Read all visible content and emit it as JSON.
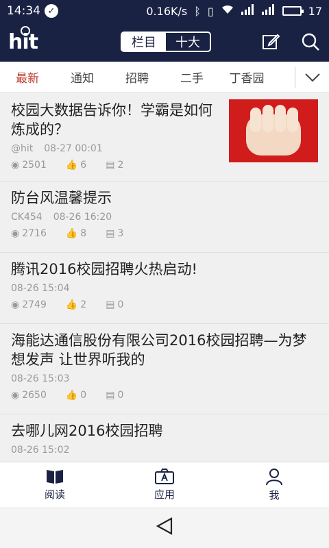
{
  "status": {
    "time": "14:34",
    "speed": "0.16K/s",
    "battery": "17"
  },
  "appbar": {
    "logo": "hit",
    "seg_left": "栏目",
    "seg_right": "十大"
  },
  "tabs": [
    "最新",
    "通知",
    "招聘",
    "二手",
    "丁香园"
  ],
  "articles": [
    {
      "title": "校园大数据告诉你！学霸是如何炼成的？",
      "author": "@hit",
      "time": "08-27 00:01",
      "views": "2501",
      "likes": "6",
      "comments": "2",
      "has_thumb": true
    },
    {
      "title": "防台风温馨提示",
      "author": "CK454",
      "time": "08-26 16:20",
      "views": "2716",
      "likes": "8",
      "comments": "3"
    },
    {
      "title": "腾讯2016校园招聘火热启动!",
      "author": "",
      "time": "08-26 15:04",
      "views": "2749",
      "likes": "2",
      "comments": "0"
    },
    {
      "title": "海能达通信股份有限公司2016校园招聘—为梦想发声 让世界听我的",
      "author": "",
      "time": "08-26 15:03",
      "views": "2650",
      "likes": "0",
      "comments": "0"
    },
    {
      "title": "去哪儿网2016校园招聘",
      "author": "",
      "time": "08-26 15:02",
      "views": "",
      "likes": "",
      "comments": ""
    }
  ],
  "nav": {
    "read": "阅读",
    "apps": "应用",
    "me": "我"
  },
  "colors": {
    "primary": "#1a2244",
    "accent": "#c0392b"
  }
}
